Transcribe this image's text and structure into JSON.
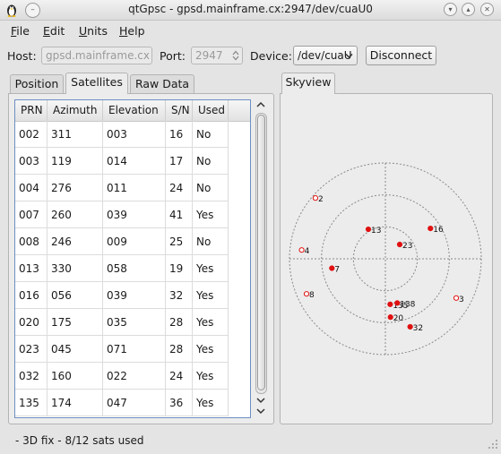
{
  "window": {
    "title": "qtGpsc - gpsd.mainframe.cx:2947/dev/cuaU0",
    "menu_button_glyph": "–",
    "minimize_glyph": "▾",
    "maximize_glyph": "▴",
    "close_glyph": "✕"
  },
  "menu": {
    "items": [
      {
        "accel": "F",
        "rest": "ile"
      },
      {
        "accel": "E",
        "rest": "dit"
      },
      {
        "accel": "U",
        "rest": "nits"
      },
      {
        "accel": "H",
        "rest": "elp"
      }
    ]
  },
  "toolbar": {
    "host_label": "Host:",
    "host_value": "gpsd.mainframe.cx",
    "port_label": "Port:",
    "port_value": "2947",
    "device_label": "Device:",
    "device_value": "/dev/cuaU",
    "disconnect_label": "Disconnect"
  },
  "tabs": {
    "position": "Position",
    "satellites": "Satellites",
    "raw_data": "Raw Data",
    "skyview": "Skyview"
  },
  "table": {
    "headers": [
      "PRN",
      "Azimuth",
      "Elevation",
      "S/N",
      "Used"
    ],
    "rows": [
      [
        "002",
        "311",
        "003",
        "16",
        "No"
      ],
      [
        "003",
        "119",
        "014",
        "17",
        "No"
      ],
      [
        "004",
        "276",
        "011",
        "24",
        "No"
      ],
      [
        "007",
        "260",
        "039",
        "41",
        "Yes"
      ],
      [
        "008",
        "246",
        "009",
        "25",
        "No"
      ],
      [
        "013",
        "330",
        "058",
        "19",
        "Yes"
      ],
      [
        "016",
        "056",
        "039",
        "32",
        "Yes"
      ],
      [
        "020",
        "175",
        "035",
        "28",
        "Yes"
      ],
      [
        "023",
        "045",
        "071",
        "28",
        "Yes"
      ],
      [
        "032",
        "160",
        "022",
        "24",
        "Yes"
      ],
      [
        "135",
        "174",
        "047",
        "36",
        "Yes"
      ]
    ]
  },
  "sky": {
    "used_color": "#e01010",
    "unused_color": "#e01010",
    "satellites": [
      {
        "label": "2",
        "azimuth": 311,
        "elevation": 3,
        "used": false
      },
      {
        "label": "3",
        "azimuth": 119,
        "elevation": 14,
        "used": false
      },
      {
        "label": "4",
        "azimuth": 276,
        "elevation": 11,
        "used": false
      },
      {
        "label": "7",
        "azimuth": 260,
        "elevation": 39,
        "used": true
      },
      {
        "label": "8",
        "azimuth": 246,
        "elevation": 9,
        "used": false
      },
      {
        "label": "13",
        "azimuth": 330,
        "elevation": 58,
        "used": true
      },
      {
        "label": "16",
        "azimuth": 56,
        "elevation": 39,
        "used": true
      },
      {
        "label": "20",
        "azimuth": 175,
        "elevation": 35,
        "used": true
      },
      {
        "label": "23",
        "azimuth": 45,
        "elevation": 71,
        "used": true
      },
      {
        "label": "32",
        "azimuth": 160,
        "elevation": 22,
        "used": true
      },
      {
        "label": "135",
        "azimuth": 174,
        "elevation": 47,
        "used": true
      },
      {
        "label": "138",
        "azimuth": 165,
        "elevation": 47,
        "used": true
      }
    ]
  },
  "status": {
    "text": "- 3D fix - 8/12 sats used"
  }
}
